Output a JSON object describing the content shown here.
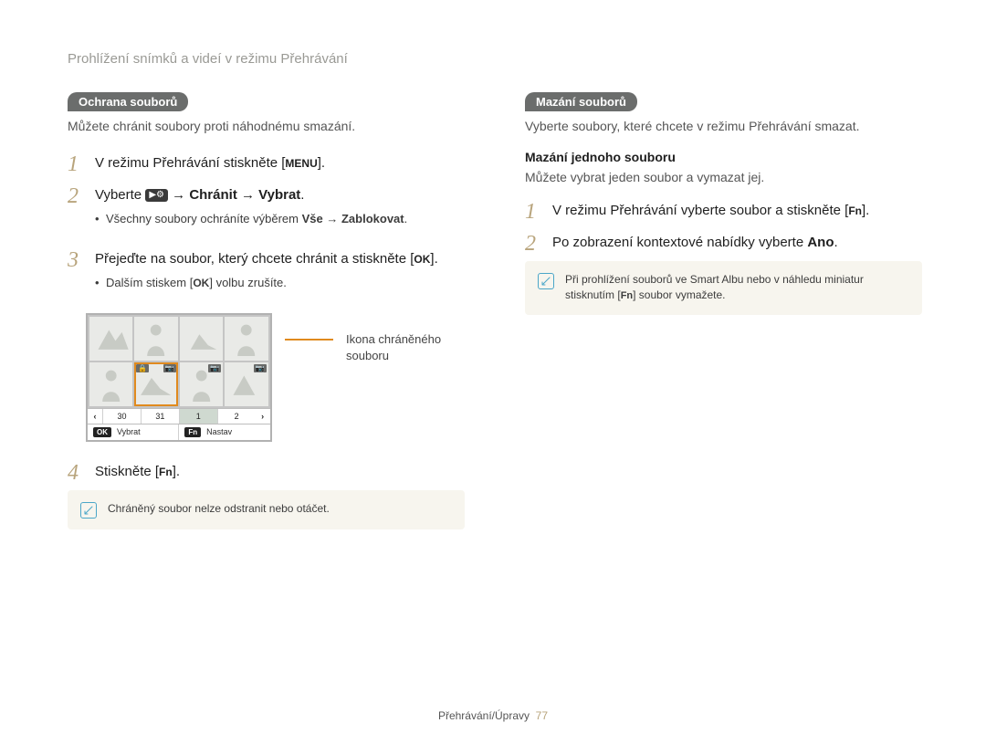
{
  "header": {
    "section_title": "Prohlížení snímků a videí v režimu Přehrávání"
  },
  "left": {
    "pill": "Ochrana souborů",
    "intro": "Můžete chránit soubory proti náhodnému smazání.",
    "steps": {
      "s1": {
        "num": "1",
        "pre": "V režimu Přehrávání stiskněte [",
        "key": "MENU",
        "post": "]."
      },
      "s2": {
        "num": "2",
        "vyberte": "Vyberte ",
        "arrow1": " → ",
        "chranit": "Chránit",
        "arrow2": " → ",
        "vybrat": "Vybrat",
        "dot": "."
      },
      "s2_bullet": {
        "pre": "Všechny soubory ochráníte výběrem ",
        "b1": "Vše",
        "arrow": " → ",
        "b2": "Zablokovat",
        "post": "."
      },
      "s3": {
        "num": "3",
        "pre": "Přejeďte na soubor, který chcete chránit a stiskněte [",
        "key": "OK",
        "post": "]."
      },
      "s3_bullet": {
        "pre": "Dalším stiskem [",
        "key": "OK",
        "post": "] volbu zrušíte."
      },
      "s4": {
        "num": "4",
        "pre": "Stiskněte [",
        "key": "Fn",
        "post": "]."
      }
    },
    "screen": {
      "dates": {
        "d1": "30",
        "d2": "31",
        "d3": "1",
        "d4": "2"
      },
      "ok_key": "OK",
      "ok_label": "Vybrat",
      "fn_key": "Fn",
      "fn_label": "Nastav"
    },
    "callout": "Ikona chráněného souboru",
    "note": "Chráněný soubor nelze odstranit nebo otáčet."
  },
  "right": {
    "pill": "Mazání souborů",
    "intro": "Vyberte soubory, které chcete v režimu Přehrávání smazat.",
    "subhead": "Mazání jednoho souboru",
    "subintro": "Můžete vybrat jeden soubor a vymazat jej.",
    "steps": {
      "s1": {
        "num": "1",
        "pre": "V režimu Přehrávání vyberte soubor a stiskněte [",
        "key": "Fn",
        "post": "]."
      },
      "s2": {
        "num": "2",
        "text": "Po zobrazení kontextové nabídky vyberte ",
        "ano": "Ano",
        "dot": "."
      }
    },
    "note": {
      "pre": "Při prohlížení souborů ve Smart Albu nebo v náhledu miniatur stisknutím [",
      "key": "Fn",
      "post": "] soubor vymažete."
    }
  },
  "footer": {
    "section": "Přehrávání/Úpravy",
    "page": "77"
  }
}
